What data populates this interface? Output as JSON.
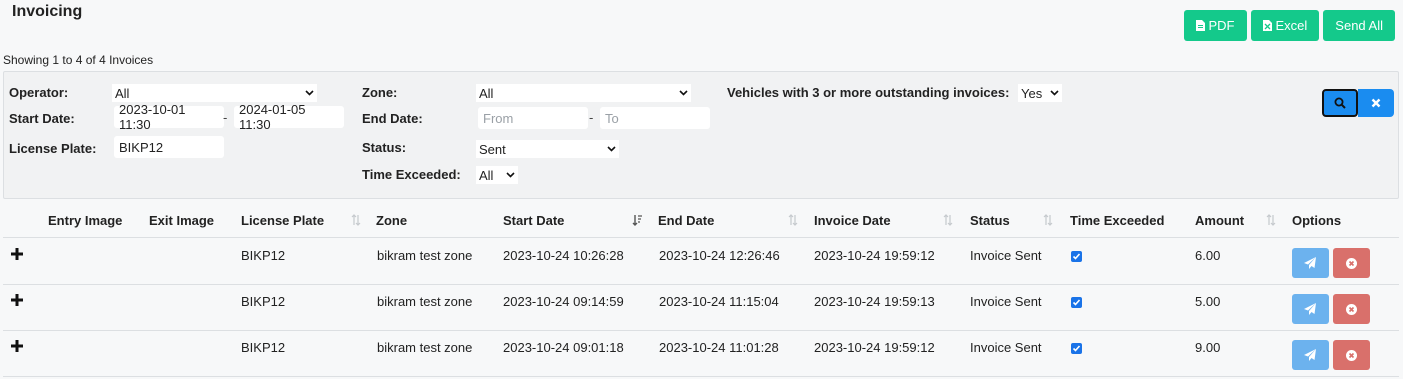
{
  "page": {
    "title": "Invoicing",
    "showing": "Showing 1 to 4 of 4 Invoices"
  },
  "toolbar": {
    "pdf_label": "PDF",
    "excel_label": "Excel",
    "send_all_label": "Send All"
  },
  "filters": {
    "operator_label": "Operator:",
    "operator_value": "All",
    "start_date_label": "Start Date:",
    "start_from": "2023-10-01 11:30",
    "start_to": "2024-01-05 11:30",
    "license_label": "License Plate:",
    "license_value": "BIKP12",
    "zone_label": "Zone:",
    "zone_value": "All",
    "end_date_label": "End Date:",
    "end_from_placeholder": "From",
    "end_to_placeholder": "To",
    "status_label": "Status:",
    "status_value": "Sent",
    "time_exceeded_label": "Time Exceeded:",
    "time_exceeded_value": "All",
    "vehicles_label": "Vehicles with 3 or more outstanding invoices:",
    "vehicles_value": "Yes",
    "dash": "-"
  },
  "table": {
    "headers": {
      "entry_image": "Entry Image",
      "exit_image": "Exit Image",
      "license_plate": "License Plate",
      "zone": "Zone",
      "start_date": "Start Date",
      "end_date": "End Date",
      "invoice_date": "Invoice Date",
      "status": "Status",
      "time_exceeded": "Time Exceeded",
      "amount": "Amount",
      "options": "Options"
    },
    "rows": [
      {
        "license_plate": "BIKP12",
        "zone": "bikram test zone",
        "start_date": "2023-10-24 10:26:28",
        "end_date": "2023-10-24 12:26:46",
        "invoice_date": "2023-10-24 19:59:12",
        "status": "Invoice Sent",
        "time_exceeded": true,
        "amount": "6.00"
      },
      {
        "license_plate": "BIKP12",
        "zone": "bikram test zone",
        "start_date": "2023-10-24 09:14:59",
        "end_date": "2023-10-24 11:15:04",
        "invoice_date": "2023-10-24 19:59:13",
        "status": "Invoice Sent",
        "time_exceeded": true,
        "amount": "5.00"
      },
      {
        "license_plate": "BIKP12",
        "zone": "bikram test zone",
        "start_date": "2023-10-24 09:01:18",
        "end_date": "2023-10-24 11:01:28",
        "invoice_date": "2023-10-24 19:59:12",
        "status": "Invoice Sent",
        "time_exceeded": true,
        "amount": "9.00"
      }
    ]
  },
  "colors": {
    "green": "#14c98b",
    "blue": "#1a8cf0",
    "send": "#6cb2ee",
    "delete": "#d9706b"
  },
  "icons": [
    "file-pdf-icon",
    "file-excel-icon",
    "search-icon",
    "close-icon",
    "plus-icon",
    "send-icon",
    "remove-icon",
    "sort-icon",
    "chevron-down-icon",
    "checkbox-icon"
  ]
}
